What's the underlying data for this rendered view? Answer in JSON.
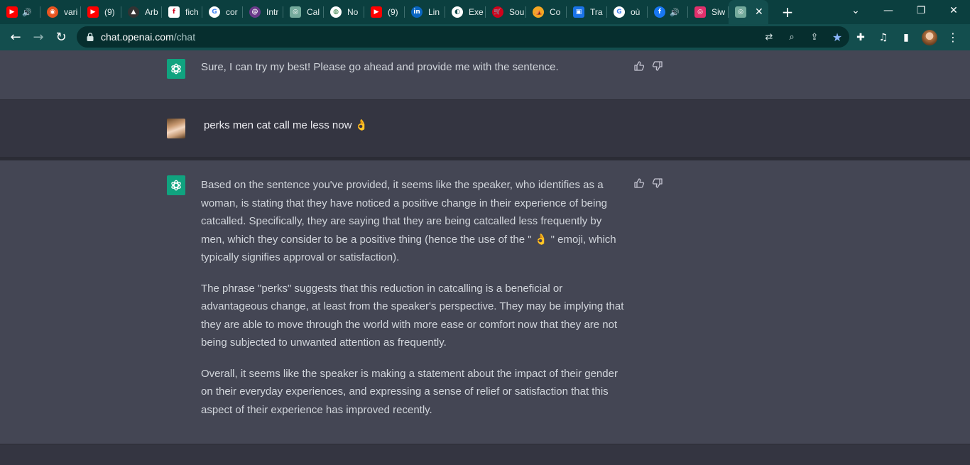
{
  "browser": {
    "tabs": [
      {
        "icon": "youtube-icon",
        "label": "",
        "audio": true,
        "color": "#ff0000"
      },
      {
        "icon": "ubuntu-icon",
        "label": "vari",
        "audio": false,
        "color": "#e95420"
      },
      {
        "icon": "youtube-icon",
        "label": "(9)",
        "audio": false,
        "color": "#ff0000"
      },
      {
        "icon": "hat-icon",
        "label": "Arb",
        "audio": false,
        "color": "#333333"
      },
      {
        "icon": "f-letter-icon",
        "label": "fich",
        "audio": false,
        "color": "#ffffff"
      },
      {
        "icon": "google-icon",
        "label": "cor",
        "audio": false,
        "color": "#ffffff"
      },
      {
        "icon": "spiral-icon",
        "label": "Intr",
        "audio": false,
        "color": "#6a3a8a"
      },
      {
        "icon": "chatgpt-icon",
        "label": "Cal",
        "audio": false,
        "color": "#74aa9c"
      },
      {
        "icon": "chrome-icon",
        "label": "No",
        "audio": false,
        "color": "#ffffff"
      },
      {
        "icon": "youtube-icon",
        "label": "(9)",
        "audio": false,
        "color": "#ff0000"
      },
      {
        "icon": "linkedin-icon",
        "label": "Lin",
        "audio": false,
        "color": "#0a66c2"
      },
      {
        "icon": "globe-icon",
        "label": "Exe",
        "audio": false,
        "color": "#ffffff"
      },
      {
        "icon": "cart-icon",
        "label": "Sou",
        "audio": false,
        "color": "#d0021b"
      },
      {
        "icon": "tent-icon",
        "label": "Co",
        "audio": false,
        "color": "#f5a623"
      },
      {
        "icon": "contact-icon",
        "label": "Tra",
        "audio": false,
        "color": "#1a73e8"
      },
      {
        "icon": "google-icon",
        "label": "où",
        "audio": false,
        "color": "#ffffff"
      },
      {
        "icon": "facebook-icon",
        "label": "",
        "audio": true,
        "color": "#1877f2"
      },
      {
        "icon": "instagram-icon",
        "label": "Siw",
        "audio": false,
        "color": "#e1306c"
      }
    ],
    "active_tab": {
      "icon": "chatgpt-icon",
      "close": "✕"
    },
    "new_tab": "+",
    "window_controls": {
      "dropdown": "⌄",
      "minimize": "—",
      "restore": "❐",
      "close": "✕"
    },
    "address": {
      "domain": "chat.openai.com",
      "path": "/chat"
    }
  },
  "conversation": {
    "messages": [
      {
        "role": "assistant",
        "paragraphs": [
          "Sure, I can try my best! Please go ahead and provide me with the sentence."
        ]
      },
      {
        "role": "user",
        "text": "perks men cat call me less now 👌"
      },
      {
        "role": "assistant",
        "paragraphs": [
          "Based on the sentence you've provided, it seems like the speaker, who identifies as a woman, is stating that they have noticed a positive change in their experience of being catcalled. Specifically, they are saying that they are being catcalled less frequently by men, which they consider to be a positive thing (hence the use of the \" 👌 \" emoji, which typically signifies approval or satisfaction).",
          "The phrase \"perks\" suggests that this reduction in catcalling is a beneficial or advantageous change, at least from the speaker's perspective. They may be implying that they are able to move through the world with more ease or comfort now that they are not being subjected to unwanted attention as frequently.",
          "Overall, it seems like the speaker is making a statement about the impact of their gender on their everyday experiences, and expressing a sense of relief or satisfaction that this aspect of their experience has improved recently."
        ]
      }
    ]
  },
  "colors": {
    "assistant_bg": "#444654",
    "user_bg": "#343541",
    "gpt_avatar": "#10a37f",
    "browser_frame": "#0b3f3f"
  }
}
